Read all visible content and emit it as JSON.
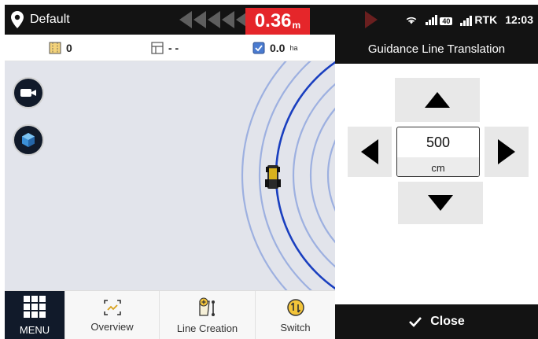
{
  "status_bar": {
    "location_name": "Default",
    "cross_track_error": "0.36",
    "cross_track_unit": "m",
    "signal_label": "40",
    "rtk_label": "RTK",
    "time": "12:03"
  },
  "info_bar": {
    "pass_count": "0",
    "area_field": "- -",
    "worked_area": "0.0",
    "worked_area_unit": "ha"
  },
  "toolbar": {
    "menu_label": "MENU",
    "overview_label": "Overview",
    "line_creation_label": "Line Creation",
    "switch_label": "Switch"
  },
  "panel": {
    "title": "Guidance Line Translation",
    "value": "500",
    "unit": "cm",
    "close_label": "Close"
  },
  "colors": {
    "status_bg": "#131313",
    "xte_red": "#e5262a",
    "guidance_line": "#1a3fbf",
    "offset_lines": "#8a9fdc",
    "map_bg": "#e2e4eb"
  }
}
